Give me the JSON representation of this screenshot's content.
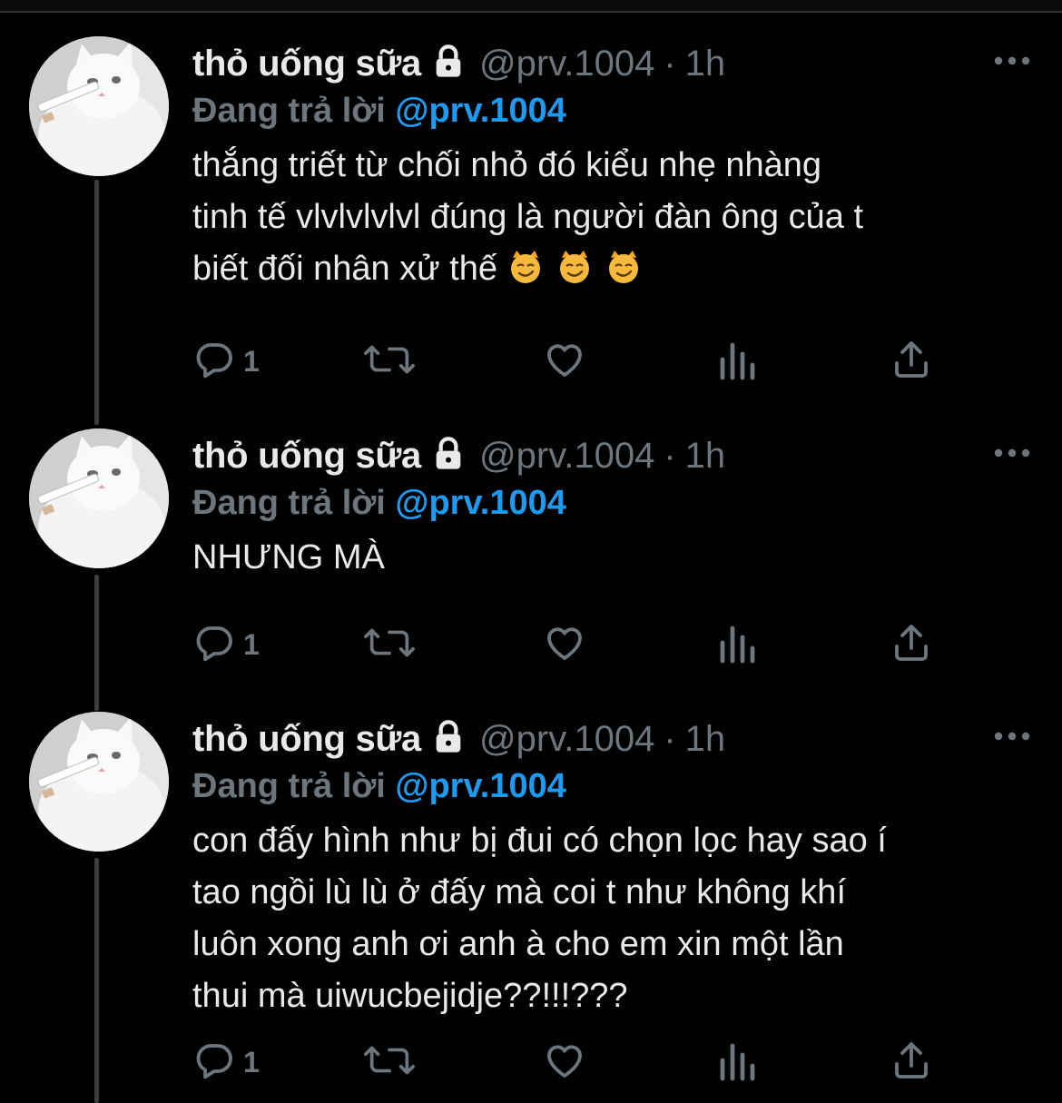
{
  "tweets": [
    {
      "display_name": "thỏ uống sữa",
      "handle": "@prv.1004",
      "separator": "·",
      "time": "1h",
      "replying_prefix": "Đang trả lời",
      "replying_to": "@prv.1004",
      "lines": [
        "thắng triết từ chối nhỏ đó kiểu nhẹ nhàng",
        "tinh tế vlvlvlvlvl đúng là người đàn ông của t",
        "biết đối nhân xử thế"
      ],
      "emojis": [
        "smirk-cat-emoji",
        "smirk-cat-emoji",
        "smirk-cat-emoji"
      ],
      "reply_count": "1"
    },
    {
      "display_name": "thỏ uống sữa",
      "handle": "@prv.1004",
      "separator": "·",
      "time": "1h",
      "replying_prefix": "Đang trả lời",
      "replying_to": "@prv.1004",
      "lines": [
        "NHƯNG MÀ"
      ],
      "emojis": [],
      "reply_count": "1"
    },
    {
      "display_name": "thỏ uống sữa",
      "handle": "@prv.1004",
      "separator": "·",
      "time": "1h",
      "replying_prefix": "Đang trả lời",
      "replying_to": "@prv.1004",
      "lines": [
        "con đấy hình như bị đui có chọn lọc hay sao í",
        "tao ngồi lù lù ở đấy mà coi t như không khí",
        "luôn xong anh ơi anh à cho em xin một lần",
        "thui mà uiwucbejidje??!!!???"
      ],
      "emojis": [],
      "reply_count": "1"
    }
  ],
  "icons": {
    "reply": "reply-icon",
    "retweet": "retweet-icon",
    "like": "heart-icon",
    "views": "analytics-icon",
    "share": "share-icon",
    "more": "more-icon",
    "lock": "lock-icon"
  },
  "colors": {
    "background": "#000000",
    "text": "#e7e9ea",
    "muted": "#6e767d",
    "accent": "#1d9bf0"
  }
}
